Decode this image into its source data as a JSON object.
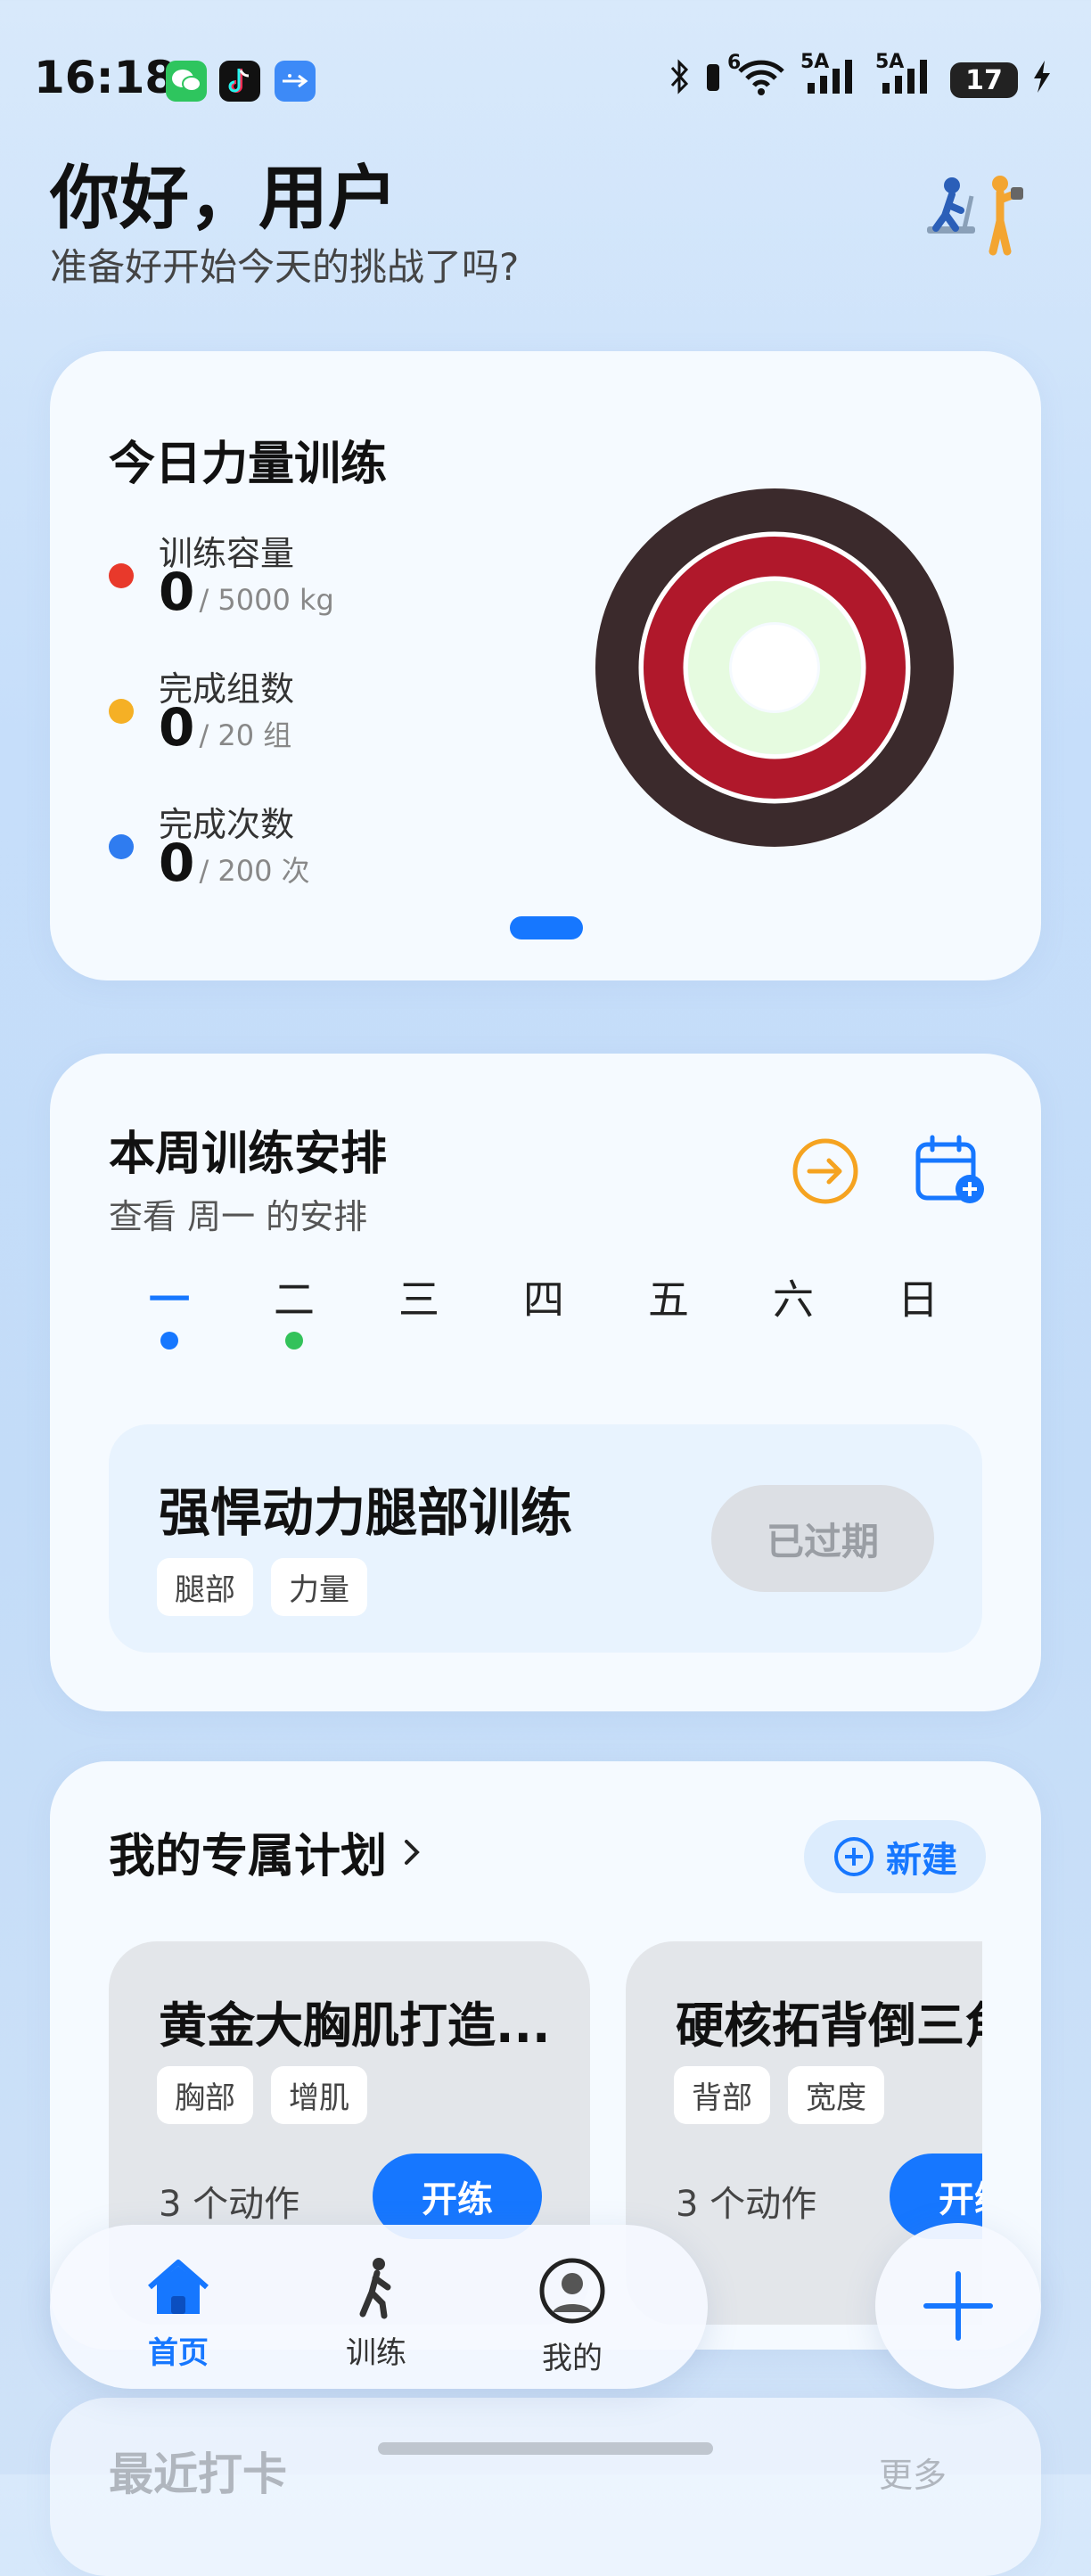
{
  "status_bar": {
    "time": "16:18",
    "network_label_1": "6",
    "network_label_2": "5A",
    "network_label_3": "5A",
    "battery": "17"
  },
  "greeting": {
    "title": "你好，用户",
    "subtitle": "准备好开始今天的挑战了吗?"
  },
  "today": {
    "title": "今日力量训练",
    "stats": [
      {
        "label": "训练容量",
        "value": "0",
        "goal": "/ 5000 kg",
        "color": "#e8392b"
      },
      {
        "label": "完成组数",
        "value": "0",
        "goal": "/ 20 组",
        "color": "#f5b025"
      },
      {
        "label": "完成次数",
        "value": "0",
        "goal": "/ 200 次",
        "color": "#2f7cf0"
      }
    ],
    "ring_colors": [
      "#3b2a2c",
      "#b0182b",
      "#e6fbe0"
    ]
  },
  "week": {
    "title": "本周训练安排",
    "subtitle": "查看 周一 的安排",
    "days": [
      "一",
      "二",
      "三",
      "四",
      "五",
      "六",
      "日"
    ],
    "workout": {
      "title": "强悍动力腿部训练",
      "tags": [
        "腿部",
        "力量"
      ],
      "status": "已过期"
    }
  },
  "plans": {
    "title": "我的专属计划",
    "new_label": "新建",
    "items": [
      {
        "title": "黄金大胸肌打造...",
        "tags": [
          "胸部",
          "增肌"
        ],
        "count": "3 个动作",
        "start": "开练"
      },
      {
        "title": "硬核拓背倒三角",
        "tags": [
          "背部",
          "宽度"
        ],
        "count": "3 个动作",
        "start": "开练"
      }
    ]
  },
  "recent": {
    "title": "最近打卡",
    "more": "更多"
  },
  "nav": {
    "home": "首页",
    "train": "训练",
    "mine": "我的"
  },
  "accent_color": "#1677ff"
}
